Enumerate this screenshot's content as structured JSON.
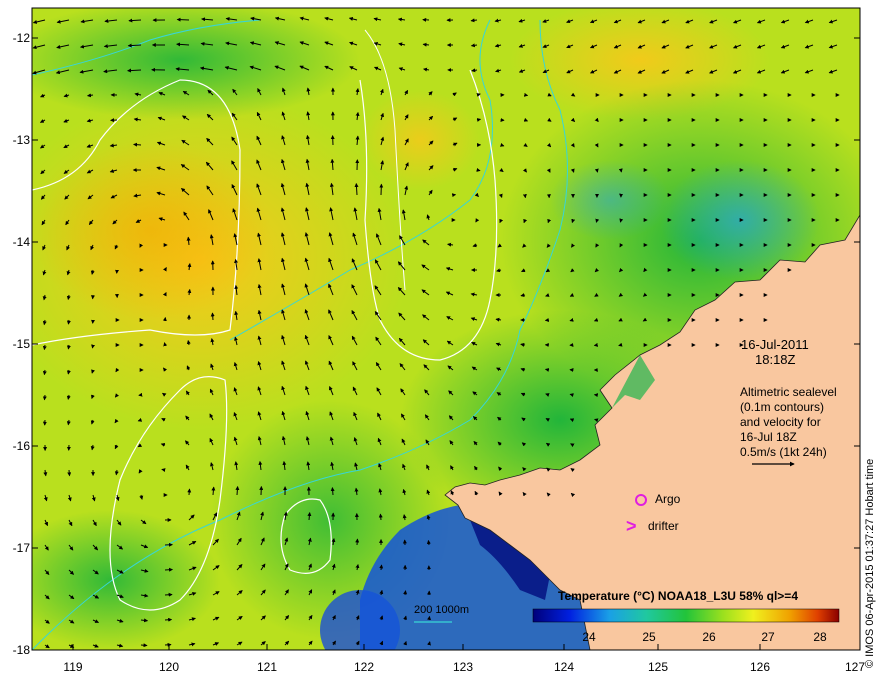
{
  "map": {
    "date": "16-Jul-2011",
    "time": "18:18Z",
    "legend_lines": [
      "Altimetric sealevel",
      "(0.1m contours)",
      "and velocity for",
      "16-Jul 18Z",
      "0.5m/s (1kt 24h)"
    ],
    "argo_label": "Argo",
    "drifter_label": "drifter",
    "drifter_symbol": ">",
    "depth_label": "200  1000m",
    "credit": "© IMOS 06-Apr-2015 01:37:27 Hobart time",
    "lat_ticks": [
      "-12",
      "-13",
      "-14",
      "-15",
      "-16",
      "-17",
      "-18"
    ],
    "lon_ticks": [
      "119",
      "120",
      "121",
      "122",
      "123",
      "124",
      "125",
      "126",
      "127"
    ],
    "colorbar": {
      "title": "Temperature (°C) NOAA18_L3U 58% ql>=4",
      "ticks": [
        "24",
        "25",
        "26",
        "27",
        "28"
      ],
      "range": [
        23.5,
        28.5
      ]
    },
    "colors": {
      "land": "#f9c79f",
      "contour": "#ffffff",
      "bathymetry": "#38d6d6",
      "argo": "#e01ee0",
      "drifter": "#e01ee0"
    }
  }
}
